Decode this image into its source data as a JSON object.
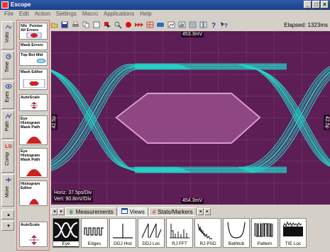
{
  "window": {
    "title": "Escope",
    "controls": [
      "_",
      "□",
      "×"
    ]
  },
  "menu": [
    "File",
    "Edit",
    "Action",
    "Settings",
    "Macro",
    "Applications",
    "Help"
  ],
  "toolbar": {
    "icons": [
      "open-icon",
      "save-icon",
      "print-icon",
      "copy-icon",
      "clear-icon",
      "select-icon",
      "zoom-icon",
      "record-icon",
      "forward-icon",
      "grid-icon",
      "display-icon",
      "image-icon",
      "histogram-icon",
      "list-icon",
      "compare-icon",
      "help-icon",
      "whats-this-icon"
    ],
    "elapsed_label": "Elapsed: 1323ms"
  },
  "side_tabs": [
    {
      "label": "Volts",
      "icon": "volts-icon"
    },
    {
      "label": "Time",
      "icon": "time-icon"
    },
    {
      "label": "Eyes",
      "icon": "eye-icon"
    },
    {
      "label": "Path",
      "icon": "path-icon"
    },
    {
      "label": "Comp",
      "icon": "comp-icon"
    },
    {
      "label": "More",
      "icon": "more-icon"
    }
  ],
  "palette": [
    {
      "label": "Nfo_Pointer All Errors"
    },
    {
      "label": "Mask Errors"
    },
    {
      "label": "Top Bot Mid"
    },
    {
      "label": "Mask Editor"
    },
    {
      "label": "AutoScale"
    },
    {
      "label": "Eye Histogram Mask Path"
    },
    {
      "label": "Eye Histogram Mask Path"
    },
    {
      "label": "Histogram Editor"
    },
    {
      "label": "AutoScale"
    }
  ],
  "scope": {
    "top_readout": "453.3mV",
    "bottom_readout": "454.3mV",
    "left_readout": "42.5p",
    "right_readout": "42.5p",
    "horiz": "Horiz: 37.5ps/Div",
    "vert": "Vert: 90.8mV/Div",
    "colors": {
      "background": "#5c1e55",
      "trace": "#25d4c8",
      "mask": "#e7b0dc",
      "grid": "#d8a0d0"
    }
  },
  "tabs": [
    {
      "label": "Measurements",
      "icon": "measurements-icon"
    },
    {
      "label": "Views",
      "icon": "views-icon"
    },
    {
      "label": "Stats/Markers",
      "icon": "stats-icon"
    }
  ],
  "views": [
    {
      "label": "Eye",
      "icon": "eye-view-icon"
    },
    {
      "label": "Edges",
      "icon": "edges-icon"
    },
    {
      "label": "DDJ Hist",
      "icon": "ddj-hist-icon"
    },
    {
      "label": "DDJ Loc",
      "icon": "ddj-loc-icon"
    },
    {
      "label": "RJ FFT",
      "icon": "rj-fft-icon"
    },
    {
      "label": "RJ PSD",
      "icon": "rj-psd-icon"
    },
    {
      "label": "Bathtub",
      "icon": "bathtub-icon"
    },
    {
      "label": "Pattern",
      "icon": "pattern-icon"
    },
    {
      "label": "TIE Loc",
      "icon": "tie-loc-icon"
    }
  ]
}
